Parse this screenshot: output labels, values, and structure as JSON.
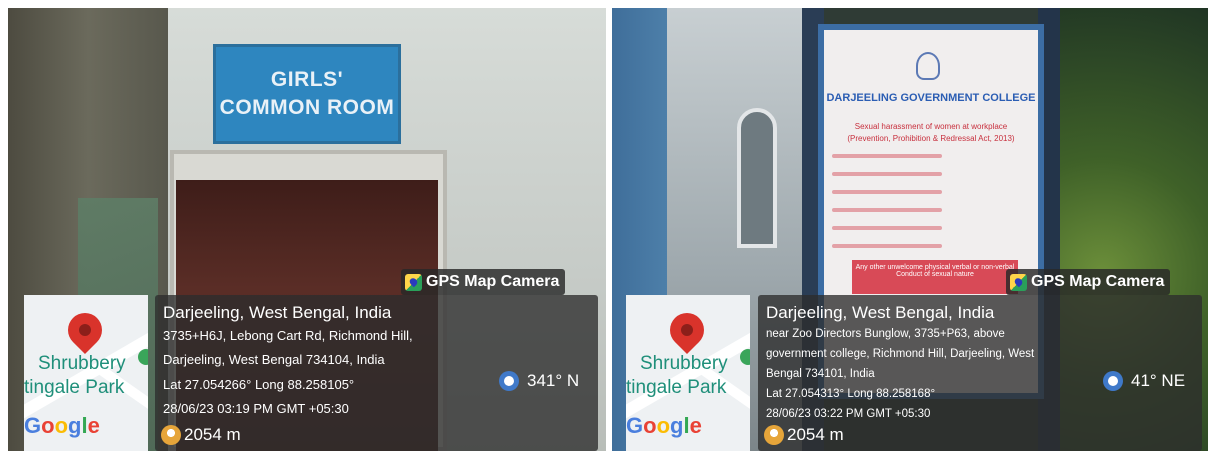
{
  "left": {
    "sign": {
      "line1": "GIRLS'",
      "line2": "COMMON ROOM"
    },
    "overlay": {
      "brand": "GPS Map Camera",
      "place": "Darjeeling, West Bengal, India",
      "address_line1": "3735+H6J, Lebong Cart Rd, Richmond Hill,",
      "address_line2": "Darjeeling, West Bengal 734104, India",
      "latlong": "Lat 27.054266° Long 88.258105°",
      "datetime": "28/06/23 03:19 PM GMT +05:30",
      "altitude": "2054 m",
      "compass": "341° N"
    },
    "map": {
      "place1": "Shrubbery",
      "place2": "tingale Park",
      "logo": "Google"
    }
  },
  "right": {
    "board": {
      "college": "DARJEELING GOVERNMENT COLLEGE",
      "subtitle": "Sexual harassment of women at workplace",
      "act": "(Prevention, Prohibition & Redressal Act, 2013)",
      "box": "Any other unwelcome physical verbal or non-verbal Conduct of sexual nature"
    },
    "overlay": {
      "brand": "GPS Map Camera",
      "place": "Darjeeling, West Bengal, India",
      "address_line1": "near Zoo Directors Bunglow, 3735+P63, above",
      "address_line2": "government college, Richmond Hill, Darjeeling, West",
      "address_line3": "Bengal 734101, India",
      "latlong": "Lat 27.054313° Long 88.258168°",
      "datetime": "28/06/23 03:22 PM GMT +05:30",
      "altitude": "2054 m",
      "compass": "41° NE"
    },
    "map": {
      "place1": "Shrubbery",
      "place2": "tingale Park",
      "logo": "Google"
    }
  }
}
